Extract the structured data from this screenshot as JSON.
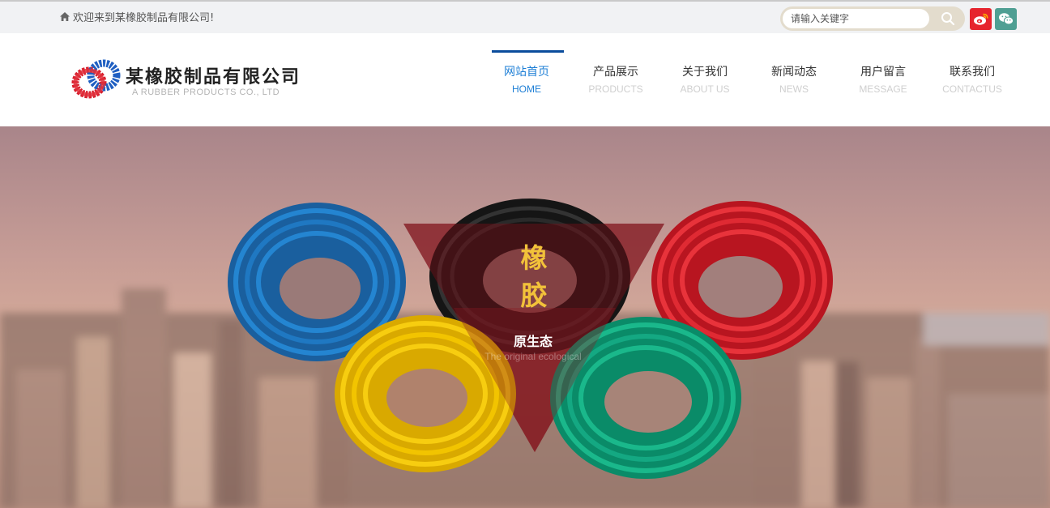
{
  "topbar": {
    "welcome_text": "欢迎来到某橡胶制品有限公司!",
    "home_icon": "home-icon",
    "search_placeholder": "请输入关键字",
    "search_icon": "search-icon",
    "social": [
      {
        "name": "weibo-icon",
        "color": "#e6242e"
      },
      {
        "name": "wechat-icon",
        "color": "#4f9f93"
      }
    ]
  },
  "logo": {
    "name": "某橡胶制品有限公司",
    "subtitle": "A RUBBER PRODUCTS CO., LTD"
  },
  "nav": {
    "items": [
      {
        "cn": "网站首页",
        "en": "HOME"
      },
      {
        "cn": "产品展示",
        "en": "PRODUCTS"
      },
      {
        "cn": "关于我们",
        "en": "ABOUT US"
      },
      {
        "cn": "新闻动态",
        "en": "NEWS"
      },
      {
        "cn": "用户留言",
        "en": "MESSAGE"
      },
      {
        "cn": "联系我们",
        "en": "CONTACTUS"
      }
    ],
    "active_color": "#1e7fd6",
    "active_bar_color": "#0a4c9c"
  },
  "banner": {
    "headline_1": "橡",
    "headline_2": "胶",
    "title": "原生态",
    "subtitle": "The original ecological",
    "hose_colors": [
      "#1f77c2",
      "#1a1a1a",
      "#e0242c",
      "#f2c400",
      "#14a882"
    ],
    "accent": "#f2c23a"
  }
}
